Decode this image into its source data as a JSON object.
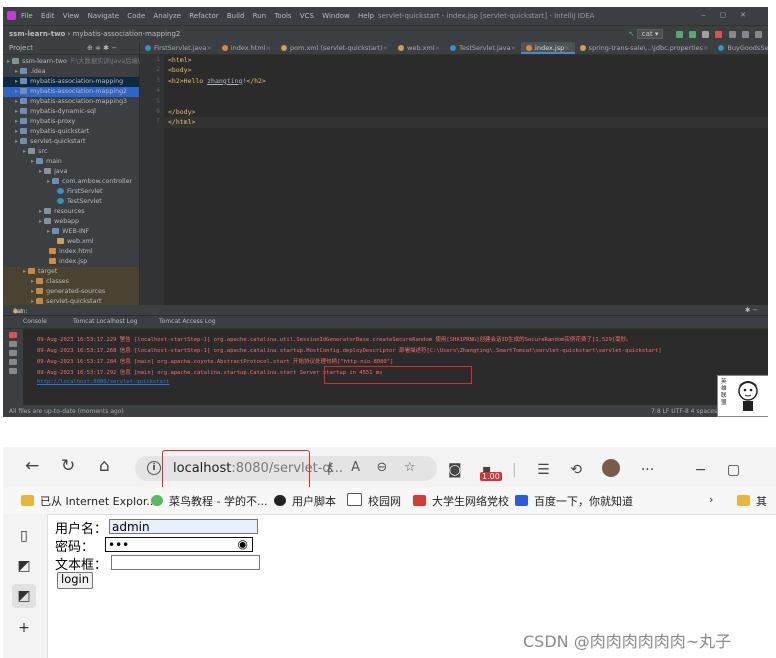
{
  "ide": {
    "menu": [
      "File",
      "Edit",
      "View",
      "Navigate",
      "Code",
      "Analyze",
      "Refactor",
      "Build",
      "Run",
      "Tools",
      "VCS",
      "Window",
      "Help"
    ],
    "window_title": "servlet-quickstart - index.jsp [servlet-quickstart] - IntelliJ IDEA",
    "breadcrumbs": [
      "ssm-learn-two",
      "mybatis-association-mapping2"
    ],
    "run_config": "cat",
    "project_label": "Project",
    "tabs": [
      "FirstServlet.java",
      "index.html",
      "pom.xml (servlet-quickstart)",
      "web.xml",
      "TestServlet.java",
      "index.jsp",
      "spring-trans-sale\\...\\jdbc.properties",
      "BuyGoodsService.java"
    ],
    "active_tab": "index.jsp",
    "tree": [
      {
        "label": "ssm-learn-two",
        "note": "F:\\大数据实训\\Java后端\\ssm-learn-two",
        "depth": 0
      },
      {
        "label": ".idea",
        "depth": 1
      },
      {
        "label": "mybatis-association-mapping",
        "depth": 1
      },
      {
        "label": "mybatis-association-mapping2",
        "depth": 1
      },
      {
        "label": "mybatis-association-mapping3",
        "depth": 1
      },
      {
        "label": "mybatis-dynamic-sql",
        "depth": 1
      },
      {
        "label": "mybatis-proxy",
        "depth": 1
      },
      {
        "label": "mybatis-quickstart",
        "depth": 1
      },
      {
        "label": "servlet-quickstart",
        "depth": 1
      },
      {
        "label": "src",
        "depth": 2
      },
      {
        "label": "main",
        "depth": 3
      },
      {
        "label": "java",
        "depth": 4
      },
      {
        "label": "com.ambow.controller",
        "depth": 5
      },
      {
        "label": "FirstServlet",
        "depth": 6
      },
      {
        "label": "TestServlet",
        "depth": 6
      },
      {
        "label": "resources",
        "depth": 4
      },
      {
        "label": "webapp",
        "depth": 4
      },
      {
        "label": "WEB-INF",
        "depth": 5
      },
      {
        "label": "web.xml",
        "depth": 6
      },
      {
        "label": "index.html",
        "depth": 5
      },
      {
        "label": "index.jsp",
        "depth": 5
      },
      {
        "label": "target",
        "depth": 2
      },
      {
        "label": "classes",
        "depth": 3
      },
      {
        "label": "generated-sources",
        "depth": 3
      },
      {
        "label": "servlet-quickstart",
        "depth": 3
      }
    ],
    "line_numbers": [
      "1",
      "2",
      "3",
      "4",
      "5",
      "6",
      "7"
    ],
    "code": {
      "l1": "<html>",
      "l2": "<body>",
      "l3_open": "<h2>Hello ",
      "l3_name": "zhangting",
      "l3_bang": "!",
      "l3_close": "</h2>",
      "l4": "",
      "l5": "",
      "l6": "</body>",
      "l7": "</html>"
    },
    "run_title": "Run:",
    "run_name": "cat",
    "run_tabs": [
      "Console",
      "Tomcat Localhost Log",
      "Tomcat Access Log"
    ],
    "console": [
      "09-Aug-2023 16:53:17.229 警告 [localhost-startStep-1] org.apache.catalina.util.SessionIdGeneratorBase.createSecureRandom 使用[SHA1PRNG]创建会话ID生成的SecureRandom实例花费了[1,529]毫秒。",
      "09-Aug-2023 16:53:17.268 信息 [localhost-startStep-1] org.apache.catalina.startup.HostConfig.deployDescriptor 部署描述符[C:\\Users\\Zhangting\\.SmartTomcat\\servlet-quickstart\\servlet-quickstart]",
      "09-Aug-2023 16:53:17.284 信息 [main] org.apache.coyote.AbstractProtocol.start 开始协议处理句柄[\"http-nio-8080\"]",
      "09-Aug-2023 16:53:17.292 信息 [main] org.apache.catalina.startup.Catalina.start Server startup in 4551 ms"
    ],
    "console_link": "http://localhost:8080/servlet-quickstart",
    "status_left": "All files are up-to-date (moments ago)",
    "status_right": "7:8  LF  UTF-8  4 spaces",
    "sticker": "英雄联盟"
  },
  "browser": {
    "url_host": "localhost",
    "url_rest": ":8080/servlet-q...",
    "badge": "1.00",
    "bookmarks": [
      "已从 Internet Explor...",
      "菜鸟教程 - 学的不...",
      "用户脚本",
      "校园网",
      "大学生网络党校",
      "百度一下，你就知道",
      "其"
    ],
    "form": {
      "username_label": "用户名：",
      "username_value": "admin",
      "password_label": "密码：",
      "password_value": "•••",
      "textbox_label": "文本框：",
      "textbox_value": "",
      "submit": "login"
    },
    "watermark": "CSDN @肉肉肉肉肉肉~丸子"
  },
  "colors": {
    "ide_bg": "#2b2b2b",
    "highlight_box": "#e02a2a",
    "console_error": "#ff6b68",
    "link": "#287bde"
  }
}
